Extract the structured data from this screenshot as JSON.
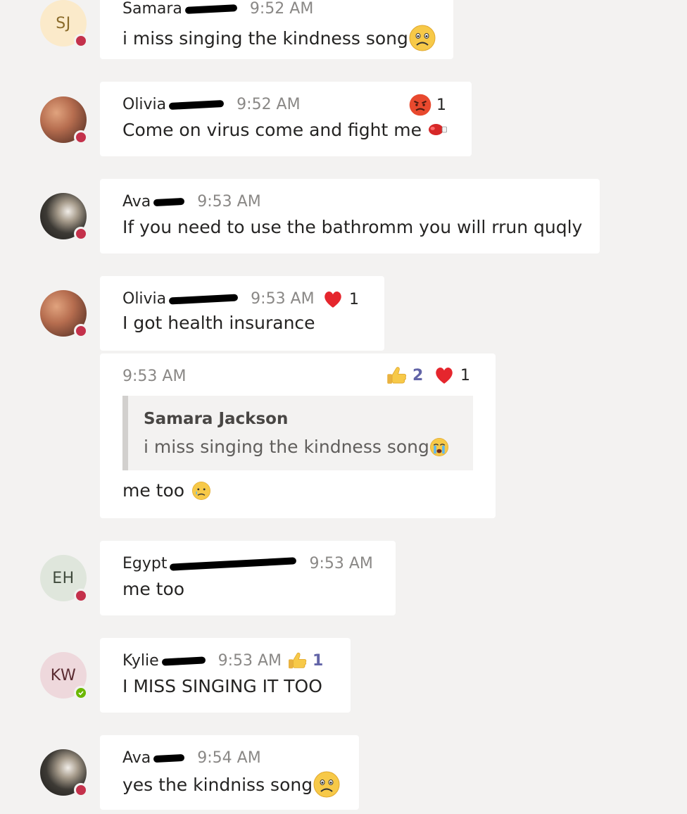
{
  "messages": [
    {
      "avatar_initials": "SJ",
      "sender": "Samara",
      "time": "9:52 AM",
      "text": "i miss singing the kindness song",
      "emoji": "worried-face-icon"
    },
    {
      "sender": "Olivia",
      "time": "9:52 AM",
      "text": "Come on virus come and fight me",
      "emoji": "boxing-glove-icon",
      "reaction": {
        "icon": "angry-face-icon",
        "count": "1"
      }
    },
    {
      "sender": "Ava",
      "time": "9:53 AM",
      "text": "If you need to use the bathromm you will rrun quqly"
    },
    {
      "sender": "Olivia",
      "time": "9:53 AM",
      "text": "I got health insurance",
      "reaction": {
        "icon": "heart-icon",
        "count": "1"
      }
    },
    {
      "time": "9:53 AM",
      "quote": {
        "name": "Samara Jackson",
        "text": "i miss singing the kindness song",
        "emoji": "crying-face-icon"
      },
      "text": "me too",
      "emoji": "crying-tear-face-icon",
      "reactions": [
        {
          "icon": "thumbs-up-icon",
          "count": "2"
        },
        {
          "icon": "heart-icon",
          "count": "1"
        }
      ]
    },
    {
      "avatar_initials": "EH",
      "sender": "Egypt",
      "time": "9:53 AM",
      "text": "me too"
    },
    {
      "avatar_initials": "KW",
      "sender": "Kylie",
      "time": "9:53 AM",
      "text": "I MISS SINGING IT TOO",
      "reaction": {
        "icon": "thumbs-up-icon",
        "count": "1"
      }
    },
    {
      "sender": "Ava",
      "time": "9:54 AM",
      "text": "yes the kindniss song",
      "emoji": "worried-face-icon"
    }
  ],
  "colors": {
    "background": "#f3f2f1",
    "bubble": "#ffffff",
    "busy": "#c4314b",
    "available": "#6bb700",
    "accent": "#6264a7"
  }
}
